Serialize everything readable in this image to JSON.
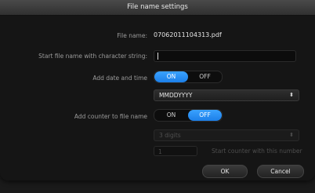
{
  "dialog": {
    "title": "File name settings",
    "file_name_label": "File name:",
    "file_name_value": "07062011104313.pdf",
    "start_string_label": "Start file name with character string:",
    "start_string_value": "",
    "date_time_label": "Add date and time",
    "date_time_on": "ON",
    "date_time_off": "OFF",
    "date_format_value": "MMDDYYYY",
    "counter_label": "Add counter to file name",
    "counter_on": "ON",
    "counter_off": "OFF",
    "counter_digits_value": "3 digits",
    "counter_start_value": "1",
    "counter_start_hint": "Start counter with this number",
    "ok_label": "OK",
    "cancel_label": "Cancel"
  },
  "state": {
    "date_time": "ON",
    "counter": "OFF"
  },
  "colors": {
    "accent": "#2a8cf4",
    "background": "#151515"
  }
}
